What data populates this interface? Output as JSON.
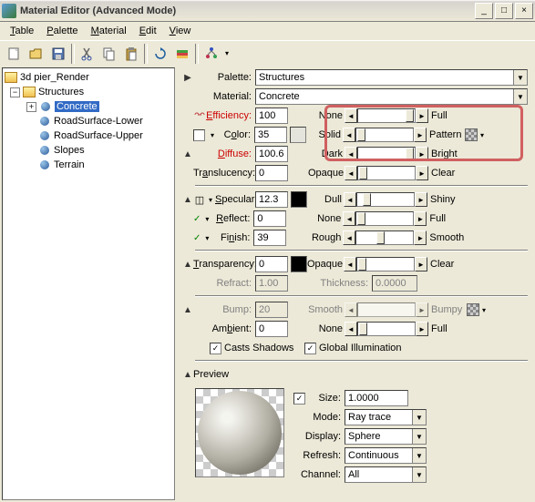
{
  "window": {
    "title": "Material Editor (Advanced Mode)"
  },
  "menus": {
    "table": "Table",
    "palette": "Palette",
    "material": "Material",
    "edit": "Edit",
    "view": "View"
  },
  "tree": {
    "root": "3d pier_Render",
    "group": "Structures",
    "items": [
      "Concrete",
      "RoadSurface-Lower",
      "RoadSurface-Upper",
      "Slopes",
      "Terrain"
    ]
  },
  "palette": {
    "label": "Palette:",
    "value": "Structures"
  },
  "material": {
    "label": "Material:",
    "value": "Concrete"
  },
  "efficiency": {
    "label": "Efficiency:",
    "value": "100",
    "left": "None",
    "right": "Full"
  },
  "color": {
    "label": "Color:",
    "value": "35",
    "left": "Solid",
    "right": "Pattern"
  },
  "diffuse": {
    "label": "Diffuse:",
    "value": "100.6",
    "left": "Dark",
    "right": "Bright"
  },
  "translucency": {
    "label": "Translucency:",
    "value": "0",
    "left": "Opaque",
    "right": "Clear"
  },
  "specular": {
    "label": "Specular:",
    "value": "12.3",
    "left": "Dull",
    "right": "Shiny"
  },
  "reflect": {
    "label": "Reflect:",
    "value": "0",
    "left": "None",
    "right": "Full"
  },
  "finish": {
    "label": "Finish:",
    "value": "39",
    "left": "Rough",
    "right": "Smooth"
  },
  "transparency": {
    "label": "Transparency:",
    "value": "0",
    "left": "Opaque",
    "right": "Clear"
  },
  "refract": {
    "label": "Refract:",
    "value": "1.00",
    "thickness_label": "Thickness:",
    "thickness_value": "0.0000"
  },
  "bump": {
    "label": "Bump:",
    "value": "20",
    "left": "Smooth",
    "right": "Bumpy"
  },
  "ambient": {
    "label": "Ambient:",
    "value": "0",
    "left": "None",
    "right": "Full"
  },
  "shadows": {
    "casts": "Casts Shadows",
    "global": "Global Illumination"
  },
  "preview": {
    "label": "Preview",
    "size_label": "Size:",
    "size_value": "1.0000",
    "mode_label": "Mode:",
    "mode_value": "Ray trace",
    "display_label": "Display:",
    "display_value": "Sphere",
    "refresh_label": "Refresh:",
    "refresh_value": "Continuous",
    "channel_label": "Channel:",
    "channel_value": "All"
  }
}
